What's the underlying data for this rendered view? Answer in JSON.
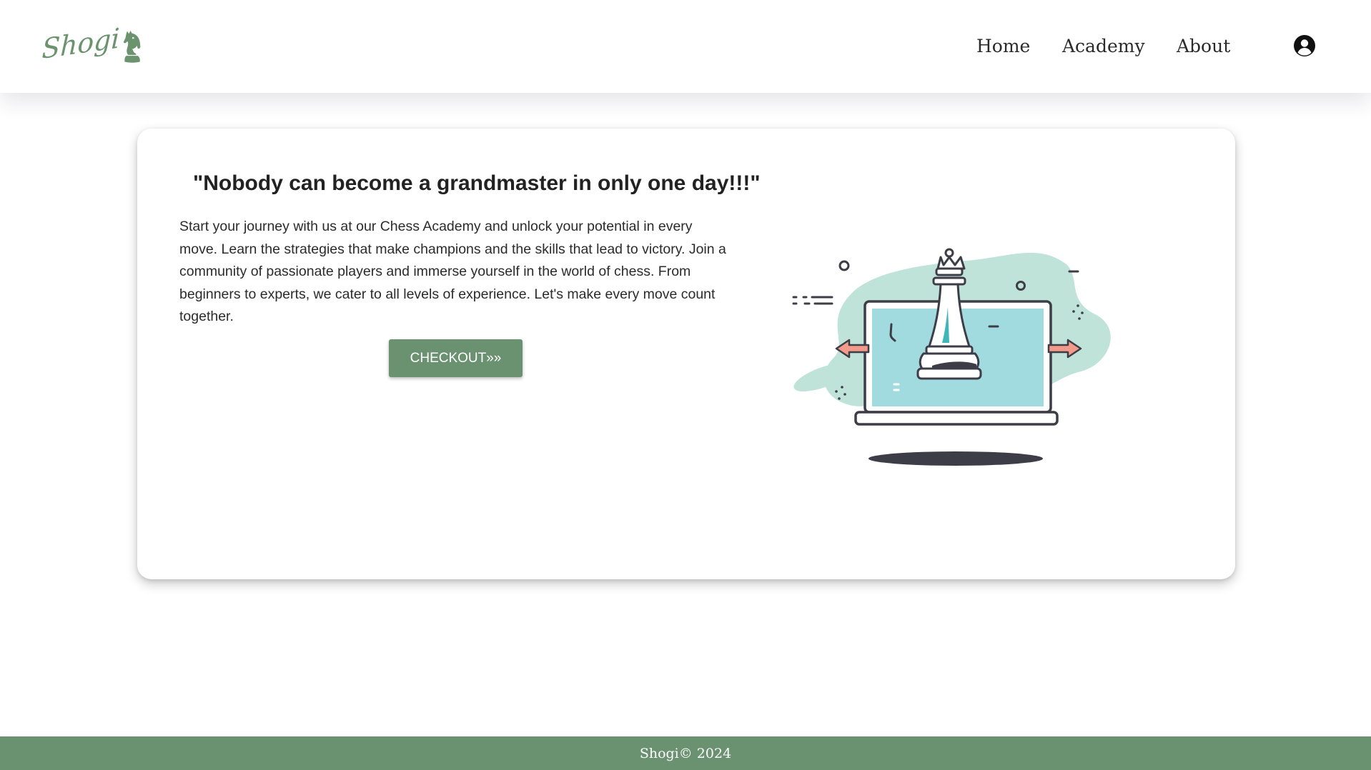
{
  "brand": {
    "name": "Shogi",
    "accent_color": "#6b9270",
    "logo_icon": "knight-icon"
  },
  "nav": {
    "items": [
      {
        "label": "Home"
      },
      {
        "label": "Academy"
      },
      {
        "label": "About"
      }
    ],
    "account_icon": "user-circle-icon"
  },
  "hero": {
    "quote": "\"Nobody can become a grandmaster in only one day!!!\"",
    "description": "Start your journey with us at our Chess Academy and unlock your potential in every move. Learn the strategies that make champions and the skills that lead to victory. Join a community of passionate players and immerse yourself in the world of chess. From beginners to experts, we cater to all levels of experience. Let's make every move count together.",
    "cta_label": "CHECKOUT»»",
    "illustration": "chess-queen-laptop-illustration"
  },
  "footer": {
    "text": "Shogi© 2024"
  }
}
